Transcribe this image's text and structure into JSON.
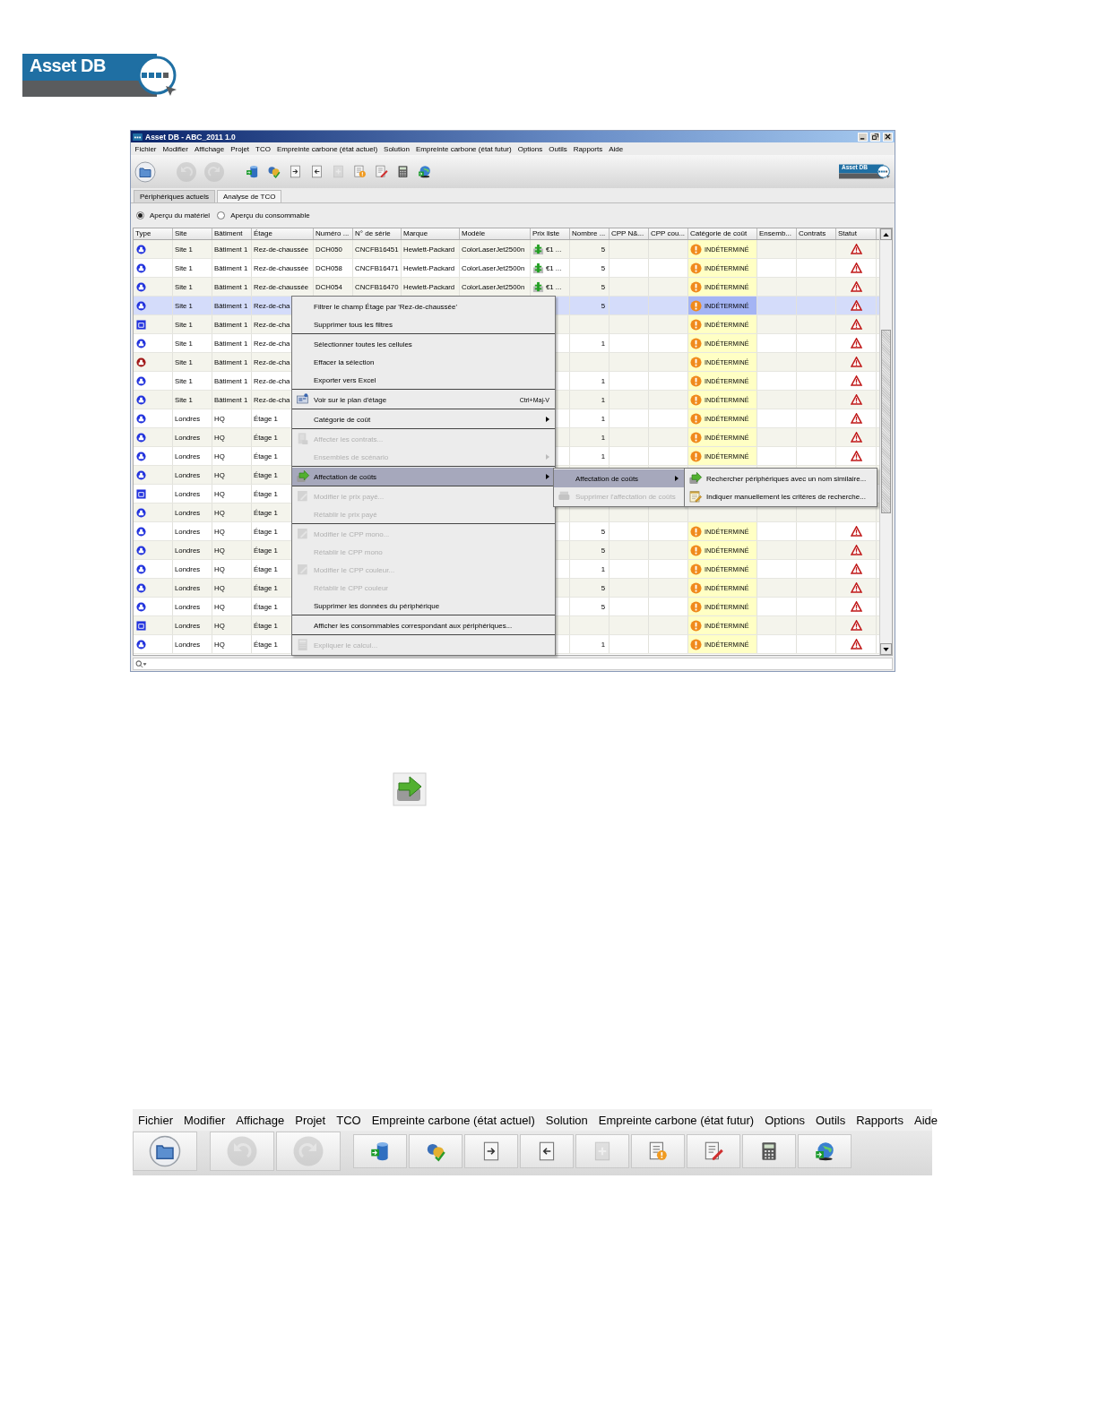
{
  "logo": {
    "text": "Asset DB"
  },
  "window": {
    "title": "Asset DB - ABC_2011 1.0"
  },
  "menu_bar": [
    "Fichier",
    "Modifier",
    "Affichage",
    "Projet",
    "TCO",
    "Empreinte carbone (état actuel)",
    "Solution",
    "Empreinte carbone (état futur)",
    "Options",
    "Outils",
    "Rapports",
    "Aide"
  ],
  "toolbar": [
    {
      "kind": "folder",
      "disabled": false
    },
    {
      "kind": "undo",
      "disabled": true
    },
    {
      "kind": "redo",
      "disabled": true
    },
    {
      "kind": "database",
      "disabled": false
    },
    {
      "kind": "currency",
      "disabled": false
    },
    {
      "kind": "doc-in",
      "disabled": false
    },
    {
      "kind": "doc-out",
      "disabled": false
    },
    {
      "kind": "doc-plain",
      "disabled": true
    },
    {
      "kind": "doc-warn",
      "disabled": false
    },
    {
      "kind": "doc-edit",
      "disabled": false
    },
    {
      "kind": "calculator",
      "disabled": false
    },
    {
      "kind": "globe",
      "disabled": false
    }
  ],
  "toolbar_logo": {
    "text": "Asset DB"
  },
  "tabs": [
    {
      "label": "Périphériques actuels",
      "selected": false
    },
    {
      "label": "Analyse de TCO",
      "selected": true
    }
  ],
  "view_options": [
    {
      "label": "Aperçu du matériel",
      "selected": true
    },
    {
      "label": "Aperçu du consommable",
      "selected": false
    }
  ],
  "table": {
    "columns": [
      "Type",
      "Site",
      "Bâtiment",
      "Étage",
      "Numéro ...",
      "N° de série",
      "Marque",
      "Modèle",
      "Prix liste",
      "Nombre ...",
      "CPP N&...",
      "CPP cou...",
      "Catégorie de coût",
      "Ensemb...",
      "Contrats",
      "Statut"
    ],
    "rows": [
      {
        "type": {
          "kind": "round",
          "color": "#2233dd"
        },
        "site": "Site 1",
        "building": "Bâtiment 1",
        "floor": "Rez-de-chaussée",
        "number": "DCH050",
        "serial": "CNCFB16451",
        "brand": "Hewlett-Packard",
        "model": "ColorLaserJet2500n",
        "price": "€1 ...",
        "count": "5",
        "category": "INDÉTERMINÉ",
        "warning": true,
        "selected": false
      },
      {
        "type": {
          "kind": "round",
          "color": "#2233dd"
        },
        "site": "Site 1",
        "building": "Bâtiment 1",
        "floor": "Rez-de-chaussée",
        "number": "DCH058",
        "serial": "CNCFB16471",
        "brand": "Hewlett-Packard",
        "model": "ColorLaserJet2500n",
        "price": "€1 ...",
        "count": "5",
        "category": "INDÉTERMINÉ",
        "warning": true,
        "selected": false
      },
      {
        "type": {
          "kind": "round",
          "color": "#2233dd"
        },
        "site": "Site 1",
        "building": "Bâtiment 1",
        "floor": "Rez-de-chaussée",
        "number": "DCH054",
        "serial": "CNCFB16470",
        "brand": "Hewlett-Packard",
        "model": "ColorLaserJet2500n",
        "price": "€1 ...",
        "count": "5",
        "category": "INDÉTERMINÉ",
        "warning": true,
        "selected": false
      },
      {
        "type": {
          "kind": "round",
          "color": "#2233dd"
        },
        "site": "Site 1",
        "building": "Bâtiment 1",
        "floor": "Rez-de-cha",
        "count": "5",
        "category": "INDÉTERMINÉ",
        "warning": true,
        "selected": true
      },
      {
        "type": {
          "kind": "square",
          "color": "#2233dd"
        },
        "site": "Site 1",
        "building": "Bâtiment 1",
        "floor": "Rez-de-cha",
        "category": "INDÉTERMINÉ",
        "warning": true,
        "selected": false
      },
      {
        "type": {
          "kind": "round",
          "color": "#2233dd"
        },
        "site": "Site 1",
        "building": "Bâtiment 1",
        "floor": "Rez-de-cha",
        "count": "1",
        "category": "INDÉTERMINÉ",
        "warning": true,
        "selected": false
      },
      {
        "type": {
          "kind": "round",
          "color": "#a01818"
        },
        "site": "Site 1",
        "building": "Bâtiment 1",
        "floor": "Rez-de-cha",
        "category": "INDÉTERMINÉ",
        "warning": true,
        "selected": false
      },
      {
        "type": {
          "kind": "round",
          "color": "#2233dd"
        },
        "site": "Site 1",
        "building": "Bâtiment 1",
        "floor": "Rez-de-cha",
        "count": "1",
        "category": "INDÉTERMINÉ",
        "warning": true,
        "selected": false
      },
      {
        "type": {
          "kind": "round",
          "color": "#2233dd"
        },
        "site": "Site 1",
        "building": "Bâtiment 1",
        "floor": "Rez-de-cha",
        "count": "1",
        "category": "INDÉTERMINÉ",
        "warning": true,
        "selected": false
      },
      {
        "type": {
          "kind": "round",
          "color": "#2233dd"
        },
        "site": "Londres",
        "building": "HQ",
        "floor": "Étage 1",
        "count": "1",
        "category": "INDÉTERMINÉ",
        "warning": true,
        "selected": false
      },
      {
        "type": {
          "kind": "round",
          "color": "#2233dd"
        },
        "site": "Londres",
        "building": "HQ",
        "floor": "Étage 1",
        "count": "1",
        "category": "INDÉTERMINÉ",
        "warning": true,
        "selected": false
      },
      {
        "type": {
          "kind": "round",
          "color": "#2233dd"
        },
        "site": "Londres",
        "building": "HQ",
        "floor": "Étage 1",
        "count": "1",
        "category": "INDÉTERMINÉ",
        "warning": true,
        "selected": false
      },
      {
        "type": {
          "kind": "round",
          "color": "#2233dd"
        },
        "site": "Londres",
        "building": "HQ",
        "floor": "Étage 1",
        "selected": false
      },
      {
        "type": {
          "kind": "square",
          "color": "#2233dd"
        },
        "site": "Londres",
        "building": "HQ",
        "floor": "Étage 1",
        "selected": false
      },
      {
        "type": {
          "kind": "round",
          "color": "#2233dd"
        },
        "site": "Londres",
        "building": "HQ",
        "floor": "Étage 1",
        "selected": false
      },
      {
        "type": {
          "kind": "round",
          "color": "#2233dd"
        },
        "site": "Londres",
        "building": "HQ",
        "floor": "Étage 1",
        "count": "5",
        "category": "INDÉTERMINÉ",
        "warning": true,
        "selected": false
      },
      {
        "type": {
          "kind": "round",
          "color": "#2233dd"
        },
        "site": "Londres",
        "building": "HQ",
        "floor": "Étage 1",
        "count": "5",
        "category": "INDÉTERMINÉ",
        "warning": true,
        "selected": false
      },
      {
        "type": {
          "kind": "round",
          "color": "#2233dd"
        },
        "site": "Londres",
        "building": "HQ",
        "floor": "Étage 1",
        "count": "1",
        "category": "INDÉTERMINÉ",
        "warning": true,
        "selected": false
      },
      {
        "type": {
          "kind": "round",
          "color": "#2233dd"
        },
        "site": "Londres",
        "building": "HQ",
        "floor": "Étage 1",
        "count": "5",
        "category": "INDÉTERMINÉ",
        "warning": true,
        "selected": false
      },
      {
        "type": {
          "kind": "round",
          "color": "#2233dd"
        },
        "site": "Londres",
        "building": "HQ",
        "floor": "Étage 1",
        "count": "5",
        "category": "INDÉTERMINÉ",
        "warning": true,
        "selected": false
      },
      {
        "type": {
          "kind": "square",
          "color": "#2233dd"
        },
        "site": "Londres",
        "building": "HQ",
        "floor": "Étage 1",
        "category": "INDÉTERMINÉ",
        "warning": true,
        "selected": false
      },
      {
        "type": {
          "kind": "round",
          "color": "#2233dd"
        },
        "site": "Londres",
        "building": "HQ",
        "floor": "Étage 1",
        "count": "1",
        "category": "INDÉTERMINÉ",
        "warning": true,
        "selected": false
      }
    ]
  },
  "context_menu": {
    "items": [
      {
        "kind": "plain",
        "label": "Filtrer le champ Étage par 'Rez-de-chaussée'",
        "disabled": false,
        "selected": false,
        "submenu": false
      },
      {
        "kind": "plain",
        "label": "Supprimer tous les filtres",
        "disabled": false,
        "selected": false,
        "submenu": false
      },
      {
        "kind": "separator"
      },
      {
        "kind": "plain",
        "label": "Sélectionner toutes les cellules",
        "disabled": false,
        "selected": false,
        "submenu": false
      },
      {
        "kind": "plain",
        "label": "Effacer la sélection",
        "disabled": false,
        "selected": false,
        "submenu": false
      },
      {
        "kind": "plain",
        "label": "Exporter vers Excel",
        "disabled": false,
        "selected": false,
        "submenu": false
      },
      {
        "kind": "separator"
      },
      {
        "kind": "map",
        "label": "Voir sur le plan d'étage",
        "shortcut": "Ctrl+Maj-V",
        "disabled": false,
        "selected": false,
        "submenu": false
      },
      {
        "kind": "separator"
      },
      {
        "kind": "plain",
        "label": "Catégorie de coût",
        "disabled": false,
        "selected": false,
        "submenu": true
      },
      {
        "kind": "separator"
      },
      {
        "kind": "contract",
        "label": "Affecter les contrats...",
        "disabled": true,
        "selected": false,
        "submenu": false
      },
      {
        "kind": "plain",
        "label": "Ensembles de scénario",
        "disabled": true,
        "selected": false,
        "submenu": true
      },
      {
        "kind": "separator"
      },
      {
        "kind": "cost",
        "label": "Affectation de coûts",
        "disabled": false,
        "selected": true,
        "submenu": true
      },
      {
        "kind": "separator"
      },
      {
        "kind": "edit",
        "label": "Modifier le prix payé...",
        "disabled": true,
        "selected": false,
        "submenu": false
      },
      {
        "kind": "plain",
        "label": "Rétablir le prix payé",
        "disabled": true,
        "selected": false,
        "submenu": false
      },
      {
        "kind": "separator"
      },
      {
        "kind": "edit",
        "label": "Modifier le CPP mono...",
        "disabled": true,
        "selected": false,
        "submenu": false
      },
      {
        "kind": "plain",
        "label": "Rétablir le CPP mono",
        "disabled": true,
        "selected": false,
        "submenu": false
      },
      {
        "kind": "edit",
        "label": "Modifier le CPP couleur...",
        "disabled": true,
        "selected": false,
        "submenu": false
      },
      {
        "kind": "plain",
        "label": "Rétablir le CPP couleur",
        "disabled": true,
        "selected": false,
        "submenu": false
      },
      {
        "kind": "plain",
        "label": "Supprimer les données du périphérique",
        "disabled": false,
        "selected": false,
        "submenu": false
      },
      {
        "kind": "separator"
      },
      {
        "kind": "plain",
        "label": "Afficher les consommables correspondant aux périphériques...",
        "disabled": false,
        "selected": false,
        "submenu": false
      },
      {
        "kind": "separator"
      },
      {
        "kind": "calc",
        "label": "Expliquer le calcul...",
        "disabled": true,
        "selected": false,
        "submenu": false
      }
    ]
  },
  "submenu": {
    "items": [
      {
        "kind": "plain",
        "label": "Affectation de coûts",
        "disabled": false,
        "selected": true,
        "submenu": true
      },
      {
        "kind": "remove",
        "label": "Supprimer l'affectation de coûts",
        "disabled": true,
        "selected": false,
        "submenu": false
      }
    ]
  },
  "submenu_2": {
    "items": [
      {
        "kind": "cost",
        "label": "Rechercher périphériques avec un nom similaire...",
        "disabled": false,
        "selected": false,
        "submenu": false
      },
      {
        "kind": "note",
        "label": "Indiquer manuellement les critères de recherche...",
        "disabled": false,
        "selected": false,
        "submenu": false
      }
    ]
  },
  "zoomed_menu_bar": [
    "Fichier",
    "Modifier",
    "Affichage",
    "Projet",
    "TCO",
    "Empreinte carbone (état actuel)",
    "Solution",
    "Empreinte carbone (état futur)",
    "Options",
    "Outils",
    "Rapports",
    "Aide"
  ],
  "zoomed_toolbar": [
    {
      "kind": "folder",
      "disabled": false
    },
    {
      "kind": "undo",
      "disabled": true
    },
    {
      "kind": "redo",
      "disabled": true
    },
    {
      "kind": "database",
      "disabled": false
    },
    {
      "kind": "currency",
      "disabled": false
    },
    {
      "kind": "doc-in",
      "disabled": false
    },
    {
      "kind": "doc-out",
      "disabled": false
    },
    {
      "kind": "doc-plain",
      "disabled": true
    },
    {
      "kind": "doc-warn",
      "disabled": false
    },
    {
      "kind": "doc-edit",
      "disabled": false
    },
    {
      "kind": "calculator",
      "disabled": false
    },
    {
      "kind": "globe",
      "disabled": false
    }
  ]
}
